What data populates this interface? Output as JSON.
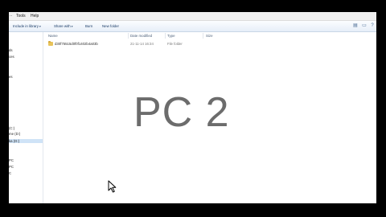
{
  "menubar": {
    "items": [
      "Tools",
      "Help"
    ]
  },
  "toolbar": {
    "include_in_library": "Include in library",
    "share_with": "Share with",
    "burn": "Burn",
    "new_folder": "New folder",
    "caret": "▾"
  },
  "columns": {
    "name": "Name",
    "date_modified": "Date modified",
    "type": "Type",
    "size": "Size"
  },
  "files": [
    {
      "name": "d30f75515d0f0f1402b4a03b",
      "date": "21-11-14 16:34",
      "type": "File folder",
      "size": ""
    }
  ],
  "nav": {
    "items": [
      {
        "label": "ds",
        "selected": false
      },
      {
        "label": "ces",
        "selected": false
      },
      {
        "label": "es",
        "selected": false
      },
      {
        "label": "(C:)",
        "selected": false
      },
      {
        "label": "me (D:)",
        "selected": false
      },
      {
        "label": "ka (G:)",
        "selected": true
      },
      {
        "label": "PC",
        "selected": false
      },
      {
        "label": "PC",
        "selected": false
      },
      {
        "label": "C",
        "selected": false
      }
    ]
  },
  "overlay_text": "PC 2"
}
